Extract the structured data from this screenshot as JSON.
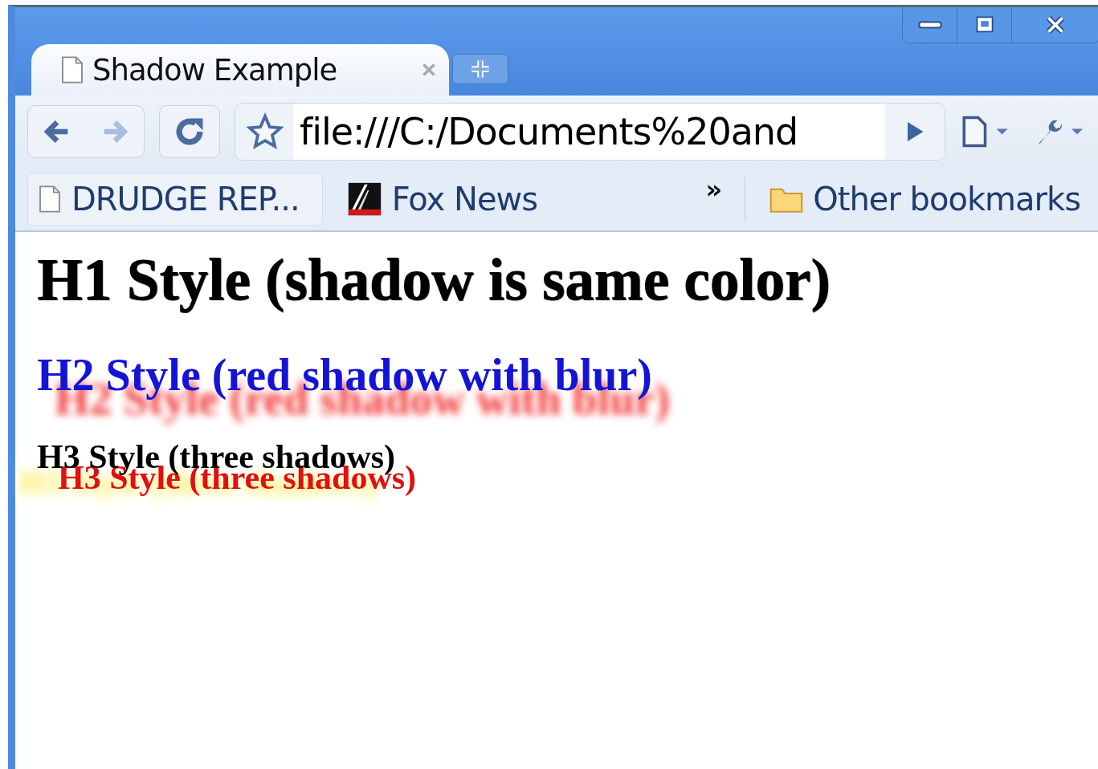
{
  "tabs": [
    {
      "title": "Shadow Example",
      "selected": true
    }
  ],
  "address_bar": {
    "url": "file:///C:/Documents%20and"
  },
  "bookmarks_bar": {
    "items": [
      {
        "label": "DRUDGE REP...",
        "kind": "page"
      },
      {
        "label": "Fox News",
        "kind": "logo"
      }
    ],
    "overflow": "»",
    "other": "Other bookmarks"
  },
  "content": [
    {
      "kind": "h1",
      "text": "H1 Style (shadow is same color)"
    },
    {
      "kind": "h2",
      "text": "H2 Style (red shadow with blur)"
    },
    {
      "kind": "h3",
      "text": "H3 Style (three shadows)"
    }
  ]
}
